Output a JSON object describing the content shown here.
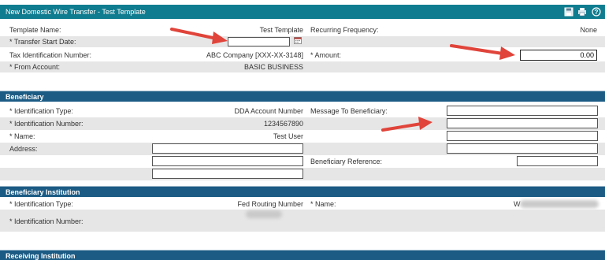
{
  "window": {
    "title": "New Domestic Wire Transfer - Test Template"
  },
  "toolbar": {
    "icons": [
      "save-icon",
      "print-icon",
      "help-icon"
    ]
  },
  "details": {
    "template_name_label": "Template Name:",
    "template_name_value": "Test Template",
    "recurring_label": "Recurring Frequency:",
    "recurring_value": "None",
    "start_date_label": "* Transfer Start Date:",
    "start_date_value": "",
    "tin_label": "Tax Identification Number:",
    "tin_value": "ABC Company [XXX-XX-3148]",
    "amount_label": "* Amount:",
    "amount_value": "0.00",
    "from_account_label": "* From Account:",
    "from_account_value": "BASIC BUSINESS"
  },
  "beneficiary": {
    "section_title": "Beneficiary",
    "id_type_label": "* Identification Type:",
    "id_type_value": "DDA Account Number",
    "id_number_label": "* Identification Number:",
    "id_number_value": "1234567890",
    "name_label": "* Name:",
    "name_value": "Test User",
    "address_label": "Address:",
    "address_lines": [
      "",
      "",
      ""
    ],
    "message_label": "Message To Beneficiary:",
    "message_lines": [
      "",
      "",
      "",
      ""
    ],
    "reference_label": "Beneficiary Reference:",
    "reference_value": ""
  },
  "beneficiary_institution": {
    "section_title": "Beneficiary Institution",
    "id_type_label": "* Identification Type:",
    "id_type_value": "Fed Routing Number",
    "name_label": "* Name:",
    "name_value_visible": "W",
    "id_number_label": "* Identification Number:"
  },
  "receiving_institution": {
    "section_title": "Receiving Institution"
  },
  "colors": {
    "title_bar": "#0f7c8f",
    "section_header": "#1b5b84",
    "row_shade": "#e6e6e6",
    "annotation_arrow": "#e0443a"
  }
}
